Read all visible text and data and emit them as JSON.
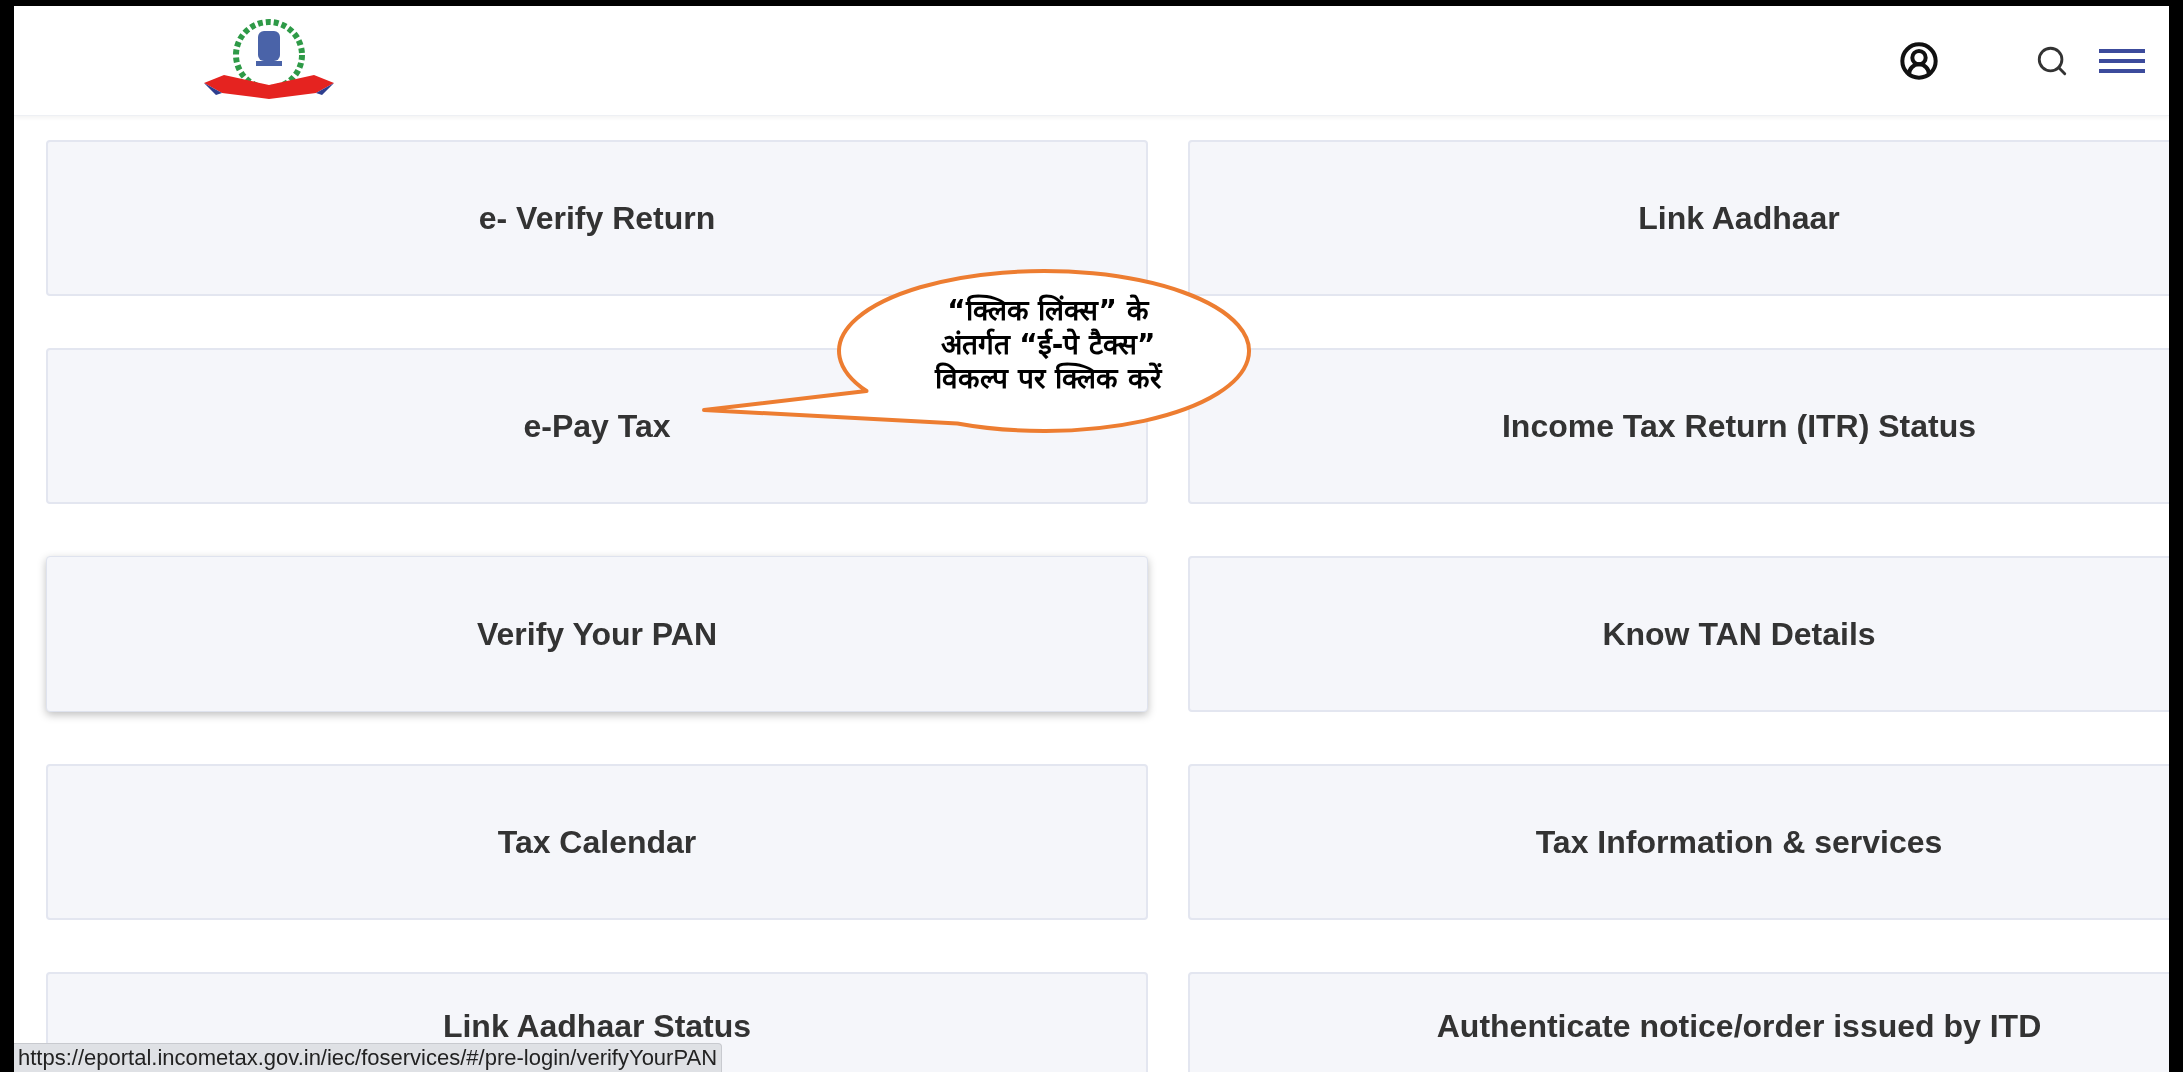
{
  "cards": [
    {
      "label": "e- Verify Return",
      "hovered": false
    },
    {
      "label": "Link Aadhaar",
      "hovered": false
    },
    {
      "label": "e-Pay Tax",
      "hovered": false
    },
    {
      "label": "Income Tax Return (ITR) Status",
      "hovered": false
    },
    {
      "label": "Verify Your PAN",
      "hovered": true
    },
    {
      "label": "Know TAN Details",
      "hovered": false
    },
    {
      "label": "Tax Calendar",
      "hovered": false
    },
    {
      "label": "Tax Information & services",
      "hovered": false
    },
    {
      "label": "Link Aadhaar Status",
      "hovered": false
    },
    {
      "label": "Authenticate notice/order issued by ITD",
      "hovered": false
    }
  ],
  "callout": {
    "text": "“क्लिक लिंक्स” के\nअंतर्गत “ई-पे टैक्स”\nविकल्प पर क्लिक करें"
  },
  "status_bar": {
    "url": "https://eportal.incometax.gov.in/iec/foservices/#/pre-login/verifyYourPAN"
  }
}
